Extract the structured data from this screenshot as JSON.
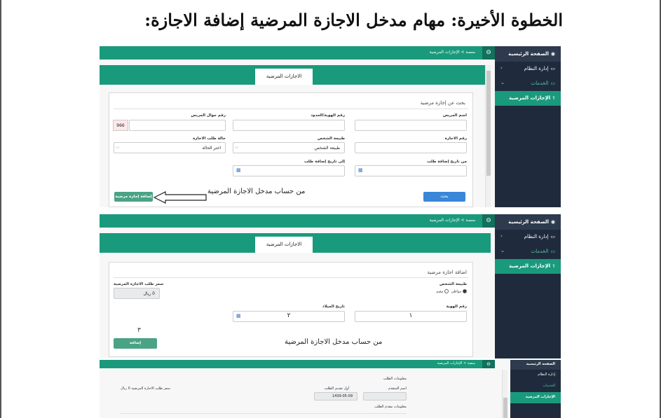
{
  "doc": {
    "title": "الخطوة الأخيرة: مهام مدخل الاجازة المرضية إضافة الاجازة:"
  },
  "sidebar": {
    "header": "منصة الخدمات الصحية",
    "home": "الصفحة الرئيسية",
    "system_admin": "إدارة النظام",
    "services": "الخدمات",
    "sick_leaves": "الإجازات المرضية"
  },
  "breadcrumb": "منصة  >  الإجازات المرضية",
  "tab_label": "الاجازات المرضية",
  "screen1": {
    "panel_title": "بحث عن إجازة مرضية",
    "patient_name_label": "اسم المريض",
    "id_label": "رقم الهوية/الحدود",
    "mobile_label": "رقم جوال المريض",
    "mobile_prefix": "966",
    "leave_no_label": "رقم الاجازة",
    "person_type_label": "طبيعة الشخص",
    "person_type_value": "طبيعة الشخص",
    "status_label": "حالة طلب الاجازة",
    "status_value": "اختر الحالة",
    "from_date_label": "من تاريخ إضافة طلب",
    "to_date_label": "إلى تاريخ إضافة طلب",
    "search_button": "بحث",
    "add_button": "إضافة إجازة مرضية",
    "note": "من حساب مدخل الاجازة المرضية"
  },
  "screen2": {
    "panel_title": "اضافة اجازة مرضية",
    "person_type_label": "طبيعة الشخص",
    "citizen": "مواطن",
    "resident": "مقيم",
    "price_label": "سعر طلب الاجازة المرضية",
    "price_value": "0 ريال",
    "id_label": "رقم الهوية",
    "birth_label": "تاريخ الميلاد",
    "step1": "١",
    "step2": "٢",
    "step3": "٣",
    "add_button": "إضافة",
    "note": "من حساب مدخل الاجازة المرضية"
  },
  "screen3": {
    "request_info": "معلومات الطلب",
    "applicant_name_label": "اسم المتقدم",
    "first_submit_label": "أول تقديم الطلب",
    "first_submit_value": "1439-05-09",
    "price_label": "سعر طلب الاجازة المرضية 0 ريال",
    "applicant_info": "معلومات مقدم الطلب"
  },
  "colors": {
    "green": "#1a9a7c",
    "sidebar": "#1f2b3d",
    "blue_button": "#3a86d9"
  }
}
